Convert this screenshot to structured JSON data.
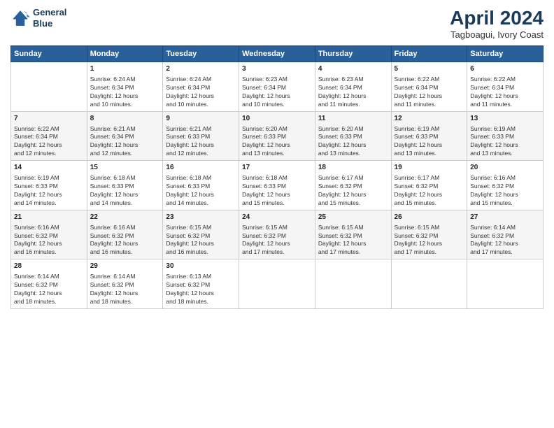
{
  "logo": {
    "line1": "General",
    "line2": "Blue"
  },
  "title": "April 2024",
  "subtitle": "Tagboagui, Ivory Coast",
  "days_header": [
    "Sunday",
    "Monday",
    "Tuesday",
    "Wednesday",
    "Thursday",
    "Friday",
    "Saturday"
  ],
  "weeks": [
    [
      {
        "num": "",
        "info": ""
      },
      {
        "num": "1",
        "info": "Sunrise: 6:24 AM\nSunset: 6:34 PM\nDaylight: 12 hours\nand 10 minutes."
      },
      {
        "num": "2",
        "info": "Sunrise: 6:24 AM\nSunset: 6:34 PM\nDaylight: 12 hours\nand 10 minutes."
      },
      {
        "num": "3",
        "info": "Sunrise: 6:23 AM\nSunset: 6:34 PM\nDaylight: 12 hours\nand 10 minutes."
      },
      {
        "num": "4",
        "info": "Sunrise: 6:23 AM\nSunset: 6:34 PM\nDaylight: 12 hours\nand 11 minutes."
      },
      {
        "num": "5",
        "info": "Sunrise: 6:22 AM\nSunset: 6:34 PM\nDaylight: 12 hours\nand 11 minutes."
      },
      {
        "num": "6",
        "info": "Sunrise: 6:22 AM\nSunset: 6:34 PM\nDaylight: 12 hours\nand 11 minutes."
      }
    ],
    [
      {
        "num": "7",
        "info": "Sunrise: 6:22 AM\nSunset: 6:34 PM\nDaylight: 12 hours\nand 12 minutes."
      },
      {
        "num": "8",
        "info": "Sunrise: 6:21 AM\nSunset: 6:34 PM\nDaylight: 12 hours\nand 12 minutes."
      },
      {
        "num": "9",
        "info": "Sunrise: 6:21 AM\nSunset: 6:33 PM\nDaylight: 12 hours\nand 12 minutes."
      },
      {
        "num": "10",
        "info": "Sunrise: 6:20 AM\nSunset: 6:33 PM\nDaylight: 12 hours\nand 13 minutes."
      },
      {
        "num": "11",
        "info": "Sunrise: 6:20 AM\nSunset: 6:33 PM\nDaylight: 12 hours\nand 13 minutes."
      },
      {
        "num": "12",
        "info": "Sunrise: 6:19 AM\nSunset: 6:33 PM\nDaylight: 12 hours\nand 13 minutes."
      },
      {
        "num": "13",
        "info": "Sunrise: 6:19 AM\nSunset: 6:33 PM\nDaylight: 12 hours\nand 13 minutes."
      }
    ],
    [
      {
        "num": "14",
        "info": "Sunrise: 6:19 AM\nSunset: 6:33 PM\nDaylight: 12 hours\nand 14 minutes."
      },
      {
        "num": "15",
        "info": "Sunrise: 6:18 AM\nSunset: 6:33 PM\nDaylight: 12 hours\nand 14 minutes."
      },
      {
        "num": "16",
        "info": "Sunrise: 6:18 AM\nSunset: 6:33 PM\nDaylight: 12 hours\nand 14 minutes."
      },
      {
        "num": "17",
        "info": "Sunrise: 6:18 AM\nSunset: 6:33 PM\nDaylight: 12 hours\nand 15 minutes."
      },
      {
        "num": "18",
        "info": "Sunrise: 6:17 AM\nSunset: 6:32 PM\nDaylight: 12 hours\nand 15 minutes."
      },
      {
        "num": "19",
        "info": "Sunrise: 6:17 AM\nSunset: 6:32 PM\nDaylight: 12 hours\nand 15 minutes."
      },
      {
        "num": "20",
        "info": "Sunrise: 6:16 AM\nSunset: 6:32 PM\nDaylight: 12 hours\nand 15 minutes."
      }
    ],
    [
      {
        "num": "21",
        "info": "Sunrise: 6:16 AM\nSunset: 6:32 PM\nDaylight: 12 hours\nand 16 minutes."
      },
      {
        "num": "22",
        "info": "Sunrise: 6:16 AM\nSunset: 6:32 PM\nDaylight: 12 hours\nand 16 minutes."
      },
      {
        "num": "23",
        "info": "Sunrise: 6:15 AM\nSunset: 6:32 PM\nDaylight: 12 hours\nand 16 minutes."
      },
      {
        "num": "24",
        "info": "Sunrise: 6:15 AM\nSunset: 6:32 PM\nDaylight: 12 hours\nand 17 minutes."
      },
      {
        "num": "25",
        "info": "Sunrise: 6:15 AM\nSunset: 6:32 PM\nDaylight: 12 hours\nand 17 minutes."
      },
      {
        "num": "26",
        "info": "Sunrise: 6:15 AM\nSunset: 6:32 PM\nDaylight: 12 hours\nand 17 minutes."
      },
      {
        "num": "27",
        "info": "Sunrise: 6:14 AM\nSunset: 6:32 PM\nDaylight: 12 hours\nand 17 minutes."
      }
    ],
    [
      {
        "num": "28",
        "info": "Sunrise: 6:14 AM\nSunset: 6:32 PM\nDaylight: 12 hours\nand 18 minutes."
      },
      {
        "num": "29",
        "info": "Sunrise: 6:14 AM\nSunset: 6:32 PM\nDaylight: 12 hours\nand 18 minutes."
      },
      {
        "num": "30",
        "info": "Sunrise: 6:13 AM\nSunset: 6:32 PM\nDaylight: 12 hours\nand 18 minutes."
      },
      {
        "num": "",
        "info": ""
      },
      {
        "num": "",
        "info": ""
      },
      {
        "num": "",
        "info": ""
      },
      {
        "num": "",
        "info": ""
      }
    ]
  ]
}
